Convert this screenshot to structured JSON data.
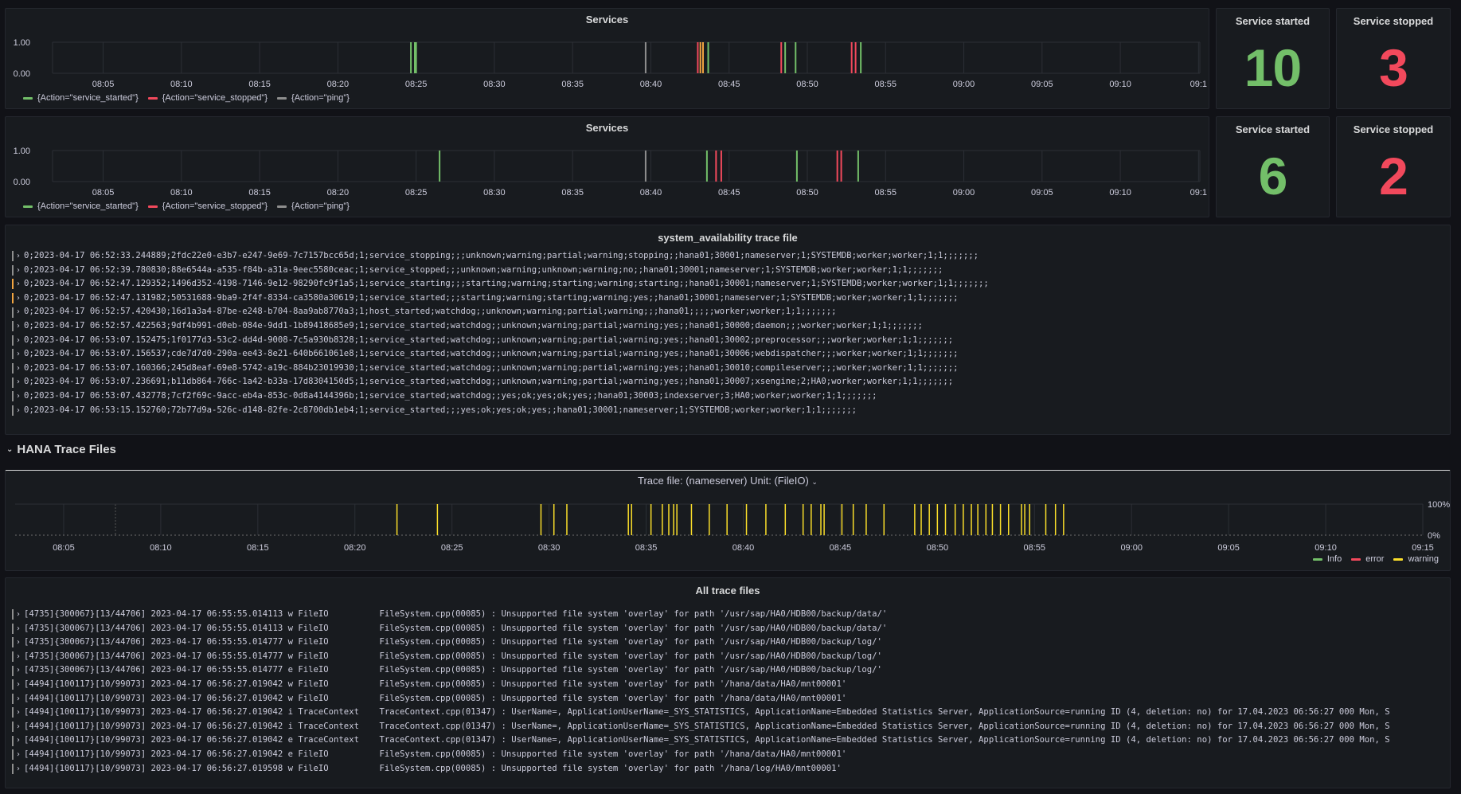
{
  "chart1": {
    "title": "Services",
    "ylabels": [
      "1.00",
      "0.00"
    ],
    "xticks": [
      "08:05",
      "08:10",
      "08:15",
      "08:20",
      "08:25",
      "08:30",
      "08:35",
      "08:40",
      "08:45",
      "08:50",
      "08:55",
      "09:00",
      "09:05",
      "09:10",
      "09:1"
    ],
    "legend": [
      "{Action=\"service_started\"}",
      "{Action=\"service_stopped\"}",
      "{Action=\"ping\"}"
    ],
    "events": [
      {
        "t": "08:24:40",
        "a": "started"
      },
      {
        "t": "08:24:55",
        "a": "started"
      },
      {
        "t": "08:25:00",
        "a": "started"
      },
      {
        "t": "08:39:40",
        "a": "ping"
      },
      {
        "t": "08:43:00",
        "a": "stopped"
      },
      {
        "t": "08:43:10",
        "a": "warning"
      },
      {
        "t": "08:43:20",
        "a": "warning"
      },
      {
        "t": "08:43:40",
        "a": "started"
      },
      {
        "t": "08:48:20",
        "a": "stopped"
      },
      {
        "t": "08:48:35",
        "a": "started"
      },
      {
        "t": "08:49:15",
        "a": "started"
      },
      {
        "t": "08:52:50",
        "a": "stopped"
      },
      {
        "t": "08:53:05",
        "a": "stopped"
      },
      {
        "t": "08:53:25",
        "a": "started"
      }
    ]
  },
  "chart2": {
    "title": "Services",
    "ylabels": [
      "1.00",
      "0.00"
    ],
    "xticks": [
      "08:05",
      "08:10",
      "08:15",
      "08:20",
      "08:25",
      "08:30",
      "08:35",
      "08:40",
      "08:45",
      "08:50",
      "08:55",
      "09:00",
      "09:05",
      "09:10",
      "09:1"
    ],
    "legend": [
      "{Action=\"service_started\"}",
      "{Action=\"service_stopped\"}",
      "{Action=\"ping\"}"
    ],
    "events": [
      {
        "t": "08:26:30",
        "a": "started"
      },
      {
        "t": "08:39:40",
        "a": "ping"
      },
      {
        "t": "08:43:35",
        "a": "started"
      },
      {
        "t": "08:44:10",
        "a": "stopped"
      },
      {
        "t": "08:44:30",
        "a": "stopped"
      },
      {
        "t": "08:49:20",
        "a": "started"
      },
      {
        "t": "08:51:55",
        "a": "stopped"
      },
      {
        "t": "08:52:10",
        "a": "stopped"
      },
      {
        "t": "08:53:15",
        "a": "started"
      }
    ]
  },
  "stat1": {
    "title": "Service started",
    "value": "10",
    "color": "#73bf69"
  },
  "stat2": {
    "title": "Service stopped",
    "value": "3",
    "color": "#f2495c"
  },
  "stat3": {
    "title": "Service started",
    "value": "6",
    "color": "#73bf69"
  },
  "stat4": {
    "title": "Service stopped",
    "value": "2",
    "color": "#f2495c"
  },
  "availability": {
    "title": "system_availability trace file",
    "rows": [
      {
        "level": "gray",
        "text": "0;2023-04-17 06:52:33.244889;2fdc22e0-e3b7-e247-9e69-7c7157bcc65d;1;service_stopping;;;unknown;warning;partial;warning;stopping;;hana01;30001;nameserver;1;SYSTEMDB;worker;worker;1;1;;;;;;;"
      },
      {
        "level": "gray",
        "text": "0;2023-04-17 06:52:39.780830;88e6544a-a535-f84b-a31a-9eec5580ceac;1;service_stopped;;;unknown;warning;unknown;warning;no;;hana01;30001;nameserver;1;SYSTEMDB;worker;worker;1;1;;;;;;;"
      },
      {
        "level": "yellow",
        "text": "0;2023-04-17 06:52:47.129352;1496d352-4198-7146-9e12-98290fc9f1a5;1;service_starting;;;starting;warning;starting;warning;starting;;hana01;30001;nameserver;1;SYSTEMDB;worker;worker;1;1;;;;;;;"
      },
      {
        "level": "yellow",
        "text": "0;2023-04-17 06:52:47.131982;50531688-9ba9-2f4f-8334-ca3580a30619;1;service_started;;;starting;warning;starting;warning;yes;;hana01;30001;nameserver;1;SYSTEMDB;worker;worker;1;1;;;;;;;"
      },
      {
        "level": "gray",
        "text": "0;2023-04-17 06:52:57.420430;16d1a3a4-87be-e248-b704-8aa9ab8770a3;1;host_started;watchdog;;unknown;warning;partial;warning;;;hana01;;;;;worker;worker;1;1;;;;;;;"
      },
      {
        "level": "gray",
        "text": "0;2023-04-17 06:52:57.422563;9df4b991-d0eb-084e-9dd1-1b89418685e9;1;service_started;watchdog;;unknown;warning;partial;warning;yes;;hana01;30000;daemon;;;worker;worker;1;1;;;;;;;"
      },
      {
        "level": "gray",
        "text": "0;2023-04-17 06:53:07.152475;1f0177d3-53c2-dd4d-9008-7c5a930b8328;1;service_started;watchdog;;unknown;warning;partial;warning;yes;;hana01;30002;preprocessor;;;worker;worker;1;1;;;;;;;"
      },
      {
        "level": "gray",
        "text": "0;2023-04-17 06:53:07.156537;cde7d7d0-290a-ee43-8e21-640b661061e8;1;service_started;watchdog;;unknown;warning;partial;warning;yes;;hana01;30006;webdispatcher;;;worker;worker;1;1;;;;;;;"
      },
      {
        "level": "gray",
        "text": "0;2023-04-17 06:53:07.160366;245d8eaf-69e8-5742-a19c-884b23019930;1;service_started;watchdog;;unknown;warning;partial;warning;yes;;hana01;30010;compileserver;;;worker;worker;1;1;;;;;;;"
      },
      {
        "level": "gray",
        "text": "0;2023-04-17 06:53:07.236691;b11db864-766c-1a42-b33a-17d8304150d5;1;service_started;watchdog;;unknown;warning;partial;warning;yes;;hana01;30007;xsengine;2;HA0;worker;worker;1;1;;;;;;;"
      },
      {
        "level": "gray",
        "text": "0;2023-04-17 06:53:07.432778;7cf2f69c-9acc-eb4a-853c-0d8a4144396b;1;service_started;watchdog;;yes;ok;yes;ok;yes;;hana01;30003;indexserver;3;HA0;worker;worker;1;1;;;;;;;"
      },
      {
        "level": "gray",
        "text": "0;2023-04-17 06:53:15.152760;72b77d9a-526c-d148-82fe-2c8700db1eb4;1;service_started;;;yes;ok;yes;ok;yes;;hana01;30001;nameserver;1;SYSTEMDB;worker;worker;1;1;;;;;;;"
      }
    ]
  },
  "row_section": {
    "title": "HANA Trace Files"
  },
  "trace_chart": {
    "title": "Trace file: (nameserver) Unit: (FileIO)",
    "xticks": [
      "08:05",
      "08:10",
      "08:15",
      "08:20",
      "08:25",
      "08:30",
      "08:35",
      "08:40",
      "08:45",
      "08:50",
      "08:55",
      "09:00",
      "09:05",
      "09:10",
      "09:15"
    ],
    "ylabels": [
      "100%",
      "0%"
    ],
    "legend": [
      "Info",
      "error",
      "warning"
    ],
    "legend_colors": [
      "#73bf69",
      "#f2495c",
      "#fade2a"
    ],
    "warning_times": [
      "08:22:10",
      "08:24:15",
      "08:29:35",
      "08:30:15",
      "08:30:55",
      "08:34:05",
      "08:34:15",
      "08:35:15",
      "08:35:50",
      "08:36:10",
      "08:36:25",
      "08:36:35",
      "08:37:20",
      "08:38:15",
      "08:39:10",
      "08:40:10",
      "08:41:10",
      "08:42:10",
      "08:43:05",
      "08:43:30",
      "08:44:00",
      "08:44:10",
      "08:45:05",
      "08:45:40",
      "08:46:20",
      "08:47:15",
      "08:48:50",
      "08:49:10",
      "08:49:35",
      "08:50:00",
      "08:50:25",
      "08:50:55",
      "08:51:20",
      "08:51:45",
      "08:52:05",
      "08:52:30",
      "08:52:50",
      "08:53:15",
      "08:53:40",
      "08:54:20",
      "08:54:30",
      "08:54:45",
      "08:55:35",
      "08:56:05",
      "08:56:30"
    ]
  },
  "all_trace": {
    "title": "All trace files",
    "rows": [
      {
        "level": "gray",
        "text": "[4735]{300067}[13/44706] 2023-04-17 06:55:55.014113 w FileIO          FileSystem.cpp(00085) : Unsupported file system 'overlay' for path '/usr/sap/HA0/HDB00/backup/data/'"
      },
      {
        "level": "gray",
        "text": "[4735]{300067}[13/44706] 2023-04-17 06:55:55.014113 w FileIO          FileSystem.cpp(00085) : Unsupported file system 'overlay' for path '/usr/sap/HA0/HDB00/backup/data/'"
      },
      {
        "level": "gray",
        "text": "[4735]{300067}[13/44706] 2023-04-17 06:55:55.014777 w FileIO          FileSystem.cpp(00085) : Unsupported file system 'overlay' for path '/usr/sap/HA0/HDB00/backup/log/'"
      },
      {
        "level": "gray",
        "text": "[4735]{300067}[13/44706] 2023-04-17 06:55:55.014777 w FileIO          FileSystem.cpp(00085) : Unsupported file system 'overlay' for path '/usr/sap/HA0/HDB00/backup/log/'"
      },
      {
        "level": "gray",
        "text": "[4735]{300067}[13/44706] 2023-04-17 06:55:55.014777 e FileIO          FileSystem.cpp(00085) : Unsupported file system 'overlay' for path '/usr/sap/HA0/HDB00/backup/log/'"
      },
      {
        "level": "gray",
        "text": "[4494]{100117}[10/99073] 2023-04-17 06:56:27.019042 w FileIO          FileSystem.cpp(00085) : Unsupported file system 'overlay' for path '/hana/data/HA0/mnt00001'"
      },
      {
        "level": "gray",
        "text": "[4494]{100117}[10/99073] 2023-04-17 06:56:27.019042 w FileIO          FileSystem.cpp(00085) : Unsupported file system 'overlay' for path '/hana/data/HA0/mnt00001'"
      },
      {
        "level": "gray",
        "text": "[4494]{100117}[10/99073] 2023-04-17 06:56:27.019042 i TraceContext    TraceContext.cpp(01347) : UserName=, ApplicationUserName=_SYS_STATISTICS, ApplicationName=Embedded Statistics Server, ApplicationSource=running ID (4, deletion: no) for 17.04.2023 06:56:27 000 Mon, S"
      },
      {
        "level": "gray",
        "text": "[4494]{100117}[10/99073] 2023-04-17 06:56:27.019042 i TraceContext    TraceContext.cpp(01347) : UserName=, ApplicationUserName=_SYS_STATISTICS, ApplicationName=Embedded Statistics Server, ApplicationSource=running ID (4, deletion: no) for 17.04.2023 06:56:27 000 Mon, S"
      },
      {
        "level": "gray",
        "text": "[4494]{100117}[10/99073] 2023-04-17 06:56:27.019042 e TraceContext    TraceContext.cpp(01347) : UserName=, ApplicationUserName=_SYS_STATISTICS, ApplicationName=Embedded Statistics Server, ApplicationSource=running ID (4, deletion: no) for 17.04.2023 06:56:27 000 Mon, S"
      },
      {
        "level": "gray",
        "text": "[4494]{100117}[10/99073] 2023-04-17 06:56:27.019042 e FileIO          FileSystem.cpp(00085) : Unsupported file system 'overlay' for path '/hana/data/HA0/mnt00001'"
      },
      {
        "level": "gray",
        "text": "[4494]{100117}[10/99073] 2023-04-17 06:56:27.019598 w FileIO          FileSystem.cpp(00085) : Unsupported file system 'overlay' for path '/hana/log/HA0/mnt00001'"
      }
    ]
  },
  "colors": {
    "started": "#73bf69",
    "stopped": "#f2495c",
    "ping": "#8e8e8e",
    "warning": "#fade2a",
    "panel": "#181b1f",
    "bg": "#111217"
  },
  "icons": {
    "row_toggle": "chevron-down-icon",
    "expand": "chevron-right-icon",
    "menu": "chevron-down-icon"
  }
}
